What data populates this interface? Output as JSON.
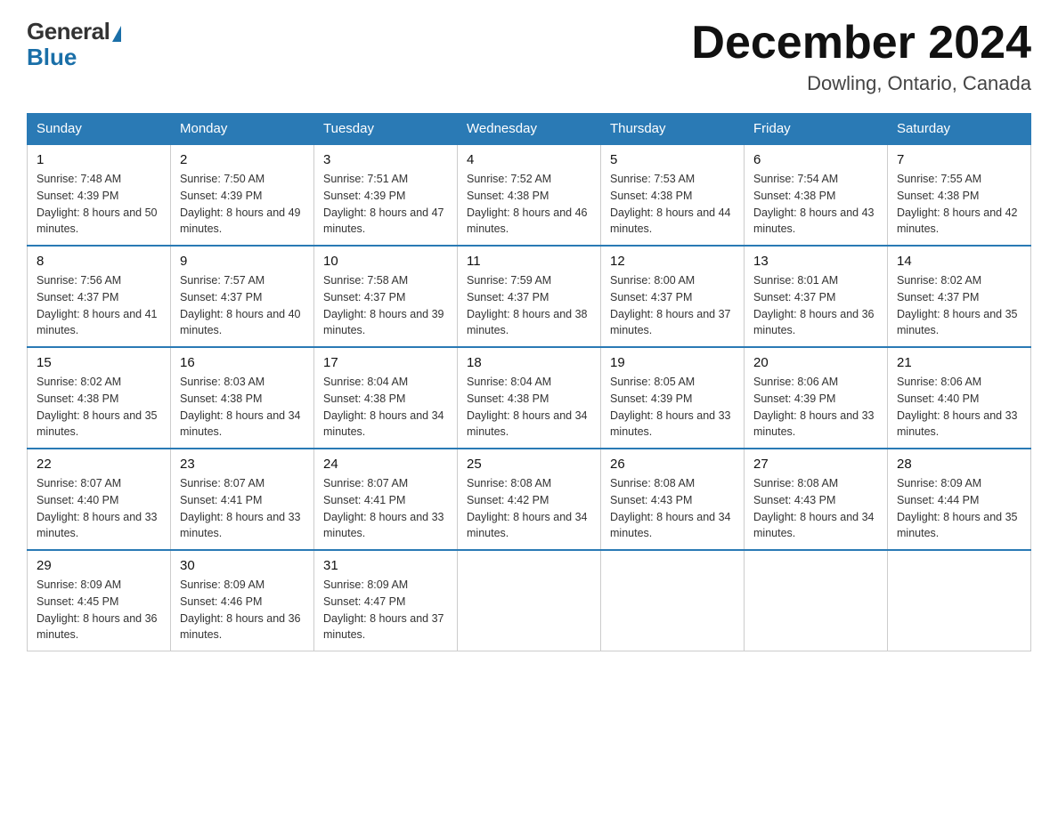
{
  "logo": {
    "general": "General",
    "blue": "Blue"
  },
  "header": {
    "month": "December 2024",
    "location": "Dowling, Ontario, Canada"
  },
  "weekdays": [
    "Sunday",
    "Monday",
    "Tuesday",
    "Wednesday",
    "Thursday",
    "Friday",
    "Saturday"
  ],
  "weeks": [
    [
      {
        "day": "1",
        "sunrise": "7:48 AM",
        "sunset": "4:39 PM",
        "daylight": "8 hours and 50 minutes."
      },
      {
        "day": "2",
        "sunrise": "7:50 AM",
        "sunset": "4:39 PM",
        "daylight": "8 hours and 49 minutes."
      },
      {
        "day": "3",
        "sunrise": "7:51 AM",
        "sunset": "4:39 PM",
        "daylight": "8 hours and 47 minutes."
      },
      {
        "day": "4",
        "sunrise": "7:52 AM",
        "sunset": "4:38 PM",
        "daylight": "8 hours and 46 minutes."
      },
      {
        "day": "5",
        "sunrise": "7:53 AM",
        "sunset": "4:38 PM",
        "daylight": "8 hours and 44 minutes."
      },
      {
        "day": "6",
        "sunrise": "7:54 AM",
        "sunset": "4:38 PM",
        "daylight": "8 hours and 43 minutes."
      },
      {
        "day": "7",
        "sunrise": "7:55 AM",
        "sunset": "4:38 PM",
        "daylight": "8 hours and 42 minutes."
      }
    ],
    [
      {
        "day": "8",
        "sunrise": "7:56 AM",
        "sunset": "4:37 PM",
        "daylight": "8 hours and 41 minutes."
      },
      {
        "day": "9",
        "sunrise": "7:57 AM",
        "sunset": "4:37 PM",
        "daylight": "8 hours and 40 minutes."
      },
      {
        "day": "10",
        "sunrise": "7:58 AM",
        "sunset": "4:37 PM",
        "daylight": "8 hours and 39 minutes."
      },
      {
        "day": "11",
        "sunrise": "7:59 AM",
        "sunset": "4:37 PM",
        "daylight": "8 hours and 38 minutes."
      },
      {
        "day": "12",
        "sunrise": "8:00 AM",
        "sunset": "4:37 PM",
        "daylight": "8 hours and 37 minutes."
      },
      {
        "day": "13",
        "sunrise": "8:01 AM",
        "sunset": "4:37 PM",
        "daylight": "8 hours and 36 minutes."
      },
      {
        "day": "14",
        "sunrise": "8:02 AM",
        "sunset": "4:37 PM",
        "daylight": "8 hours and 35 minutes."
      }
    ],
    [
      {
        "day": "15",
        "sunrise": "8:02 AM",
        "sunset": "4:38 PM",
        "daylight": "8 hours and 35 minutes."
      },
      {
        "day": "16",
        "sunrise": "8:03 AM",
        "sunset": "4:38 PM",
        "daylight": "8 hours and 34 minutes."
      },
      {
        "day": "17",
        "sunrise": "8:04 AM",
        "sunset": "4:38 PM",
        "daylight": "8 hours and 34 minutes."
      },
      {
        "day": "18",
        "sunrise": "8:04 AM",
        "sunset": "4:38 PM",
        "daylight": "8 hours and 34 minutes."
      },
      {
        "day": "19",
        "sunrise": "8:05 AM",
        "sunset": "4:39 PM",
        "daylight": "8 hours and 33 minutes."
      },
      {
        "day": "20",
        "sunrise": "8:06 AM",
        "sunset": "4:39 PM",
        "daylight": "8 hours and 33 minutes."
      },
      {
        "day": "21",
        "sunrise": "8:06 AM",
        "sunset": "4:40 PM",
        "daylight": "8 hours and 33 minutes."
      }
    ],
    [
      {
        "day": "22",
        "sunrise": "8:07 AM",
        "sunset": "4:40 PM",
        "daylight": "8 hours and 33 minutes."
      },
      {
        "day": "23",
        "sunrise": "8:07 AM",
        "sunset": "4:41 PM",
        "daylight": "8 hours and 33 minutes."
      },
      {
        "day": "24",
        "sunrise": "8:07 AM",
        "sunset": "4:41 PM",
        "daylight": "8 hours and 33 minutes."
      },
      {
        "day": "25",
        "sunrise": "8:08 AM",
        "sunset": "4:42 PM",
        "daylight": "8 hours and 34 minutes."
      },
      {
        "day": "26",
        "sunrise": "8:08 AM",
        "sunset": "4:43 PM",
        "daylight": "8 hours and 34 minutes."
      },
      {
        "day": "27",
        "sunrise": "8:08 AM",
        "sunset": "4:43 PM",
        "daylight": "8 hours and 34 minutes."
      },
      {
        "day": "28",
        "sunrise": "8:09 AM",
        "sunset": "4:44 PM",
        "daylight": "8 hours and 35 minutes."
      }
    ],
    [
      {
        "day": "29",
        "sunrise": "8:09 AM",
        "sunset": "4:45 PM",
        "daylight": "8 hours and 36 minutes."
      },
      {
        "day": "30",
        "sunrise": "8:09 AM",
        "sunset": "4:46 PM",
        "daylight": "8 hours and 36 minutes."
      },
      {
        "day": "31",
        "sunrise": "8:09 AM",
        "sunset": "4:47 PM",
        "daylight": "8 hours and 37 minutes."
      },
      null,
      null,
      null,
      null
    ]
  ]
}
